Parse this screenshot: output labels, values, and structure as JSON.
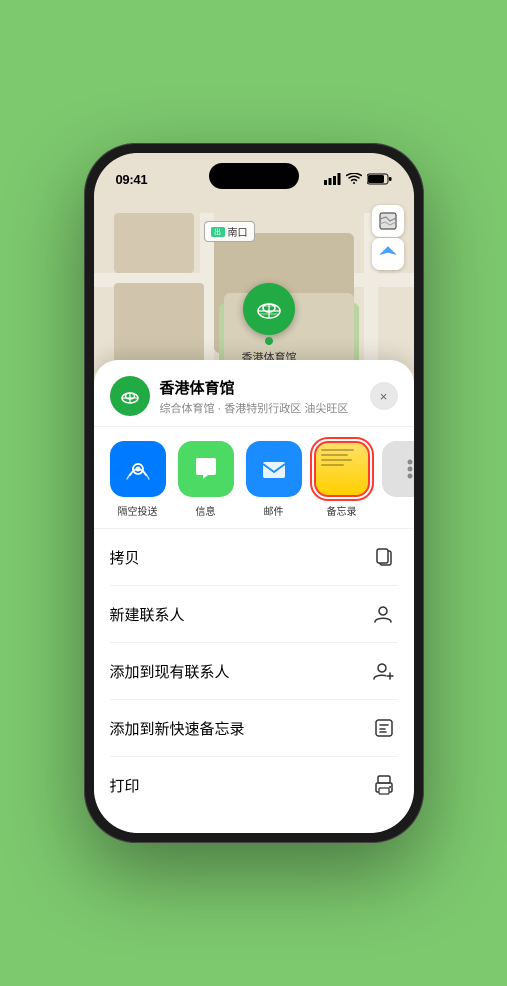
{
  "status": {
    "time": "09:41",
    "location_icon": "▶"
  },
  "map": {
    "label_text": "南口",
    "controls": {
      "map_icon": "🗺",
      "location_icon": "⬆"
    }
  },
  "pin": {
    "venue_name": "香港体育馆",
    "emoji": "🏟"
  },
  "sheet": {
    "venue_name": "香港体育馆",
    "venue_sub": "综合体育馆 · 香港特别行政区 油尖旺区",
    "close_label": "×",
    "share_items": [
      {
        "id": "airdrop",
        "label": "隔空投送",
        "emoji": "📡"
      },
      {
        "id": "messages",
        "label": "信息",
        "emoji": "💬"
      },
      {
        "id": "mail",
        "label": "邮件",
        "emoji": "✉"
      },
      {
        "id": "notes",
        "label": "备忘录",
        "emoji": "📝"
      }
    ],
    "actions": [
      {
        "id": "copy",
        "label": "拷贝",
        "icon": "copy"
      },
      {
        "id": "new-contact",
        "label": "新建联系人",
        "icon": "person-add"
      },
      {
        "id": "add-to-contact",
        "label": "添加到现有联系人",
        "icon": "person-plus"
      },
      {
        "id": "add-to-notes",
        "label": "添加到新快速备忘录",
        "icon": "note-add"
      },
      {
        "id": "print",
        "label": "打印",
        "icon": "printer"
      }
    ]
  }
}
